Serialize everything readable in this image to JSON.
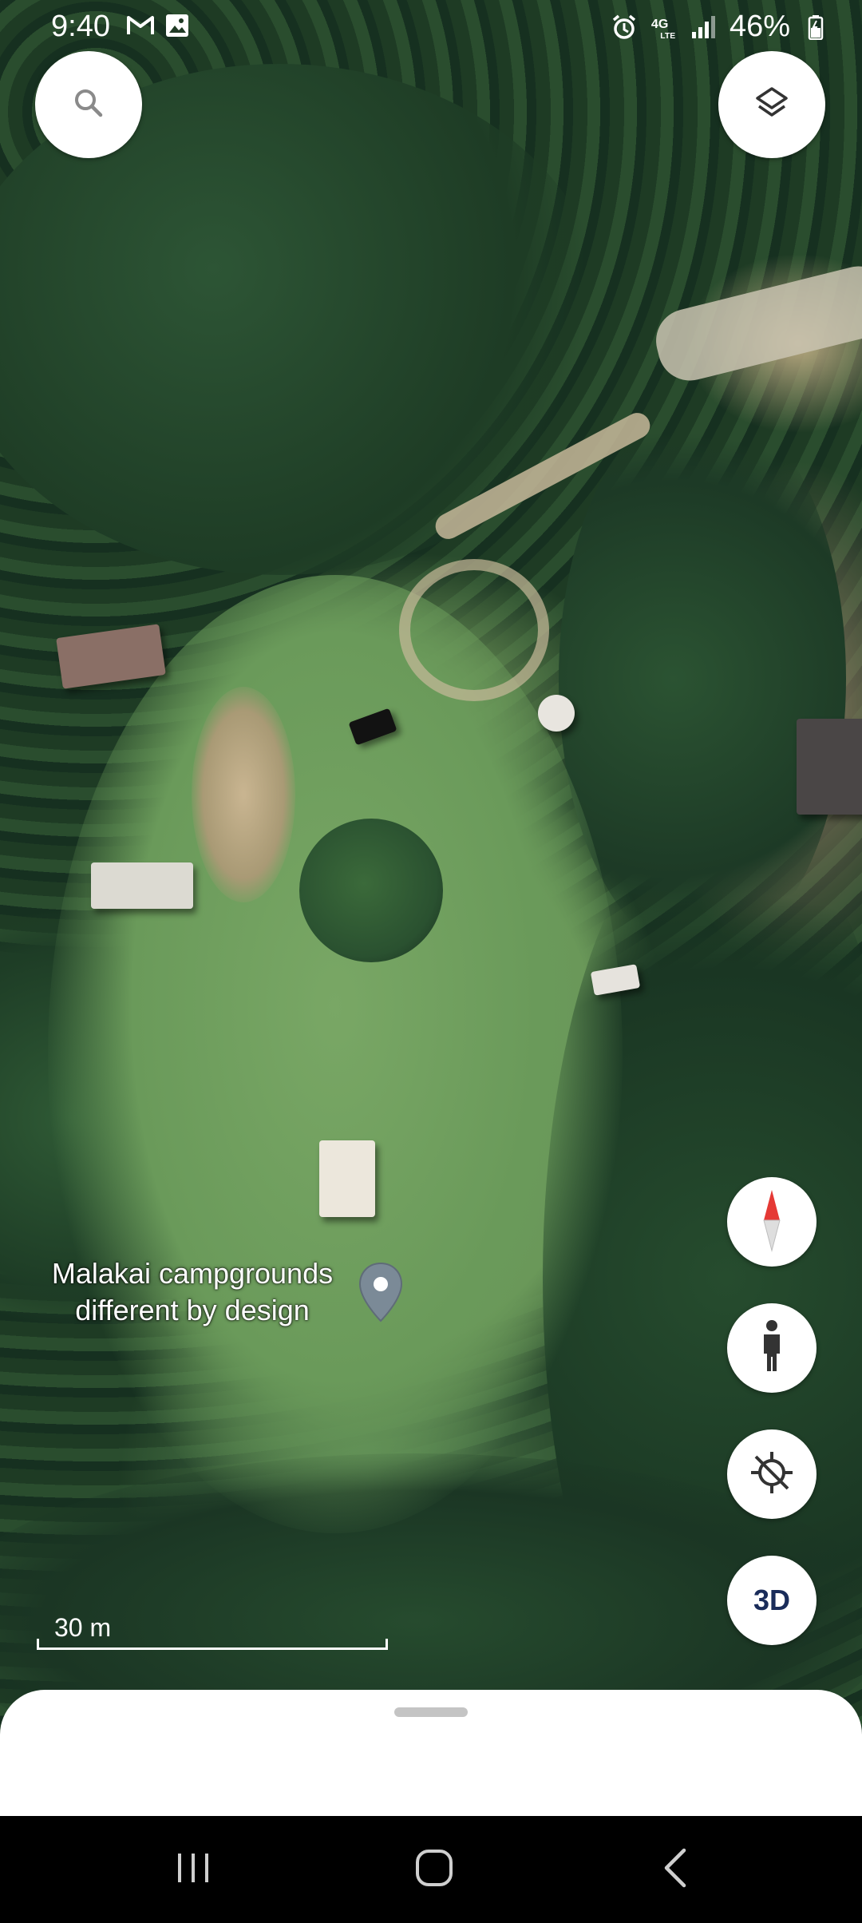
{
  "status_bar": {
    "time": "9:40",
    "left_icons": [
      "gmail-icon",
      "gallery-icon"
    ],
    "right_icons": [
      "alarm-icon",
      "4g-lte-icon",
      "signal-icon",
      "battery-icon"
    ],
    "network_label": "4G LTE",
    "battery": "46%"
  },
  "map": {
    "type": "satellite",
    "place": {
      "line1": "Malakai campgrounds",
      "line2": "different by design"
    },
    "scale": "30 m"
  },
  "controls": {
    "search_icon": "search-icon",
    "layers_icon": "layers-icon",
    "compass_icon": "compass-icon",
    "street_view_icon": "pegman-icon",
    "location_icon": "location-off-icon",
    "three_d_label": "3D"
  },
  "nav_bar": {
    "recents": "recents-icon",
    "home": "home-icon",
    "back": "back-icon"
  },
  "colors": {
    "accent_text": "#1a2c5a",
    "compass_red": "#e53935"
  }
}
